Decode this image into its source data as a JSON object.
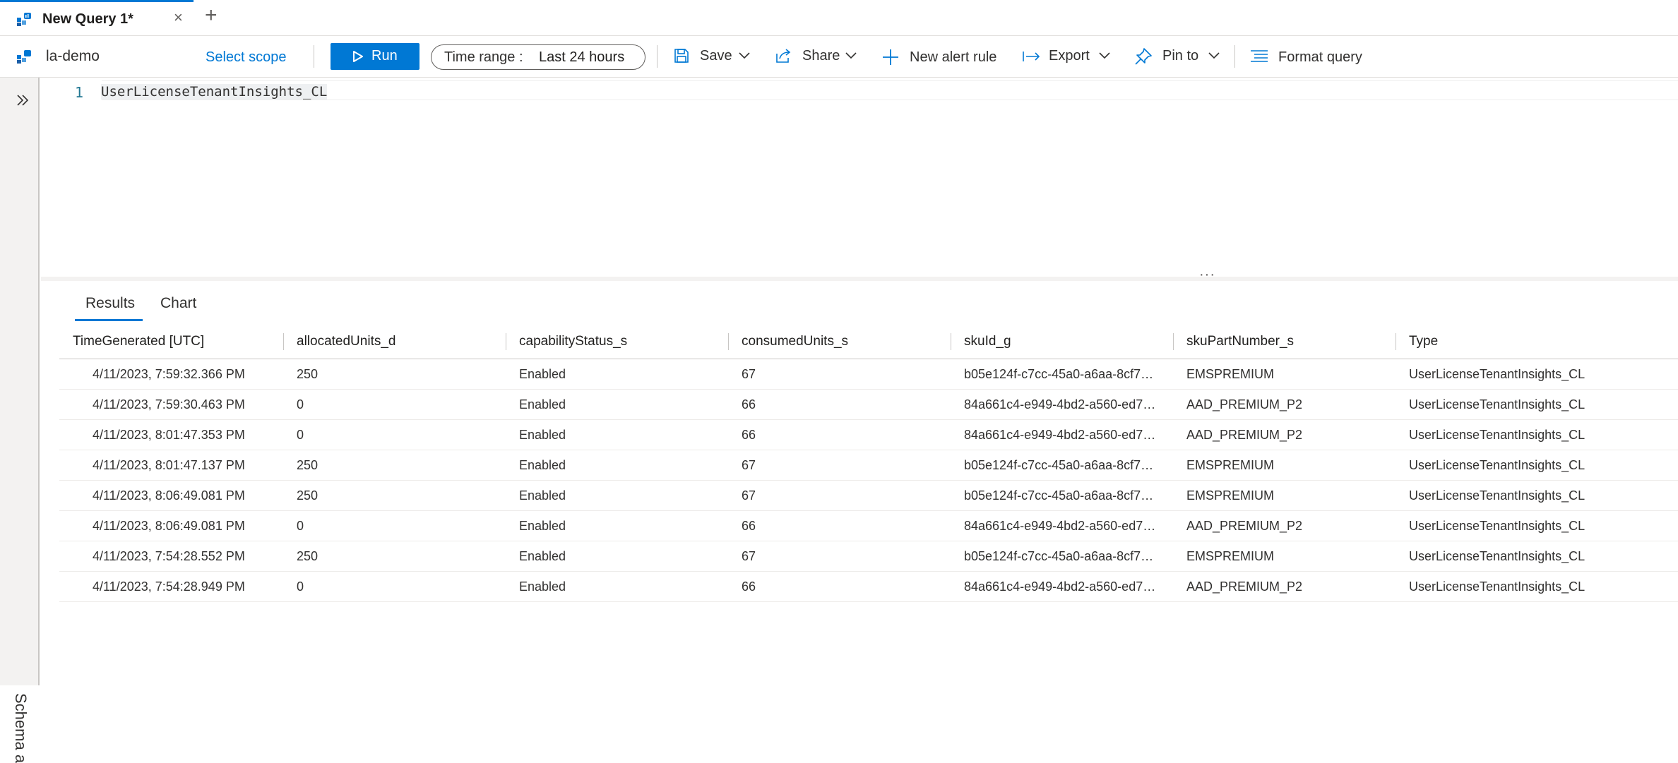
{
  "tab": {
    "title": "New Query 1*",
    "close": "×",
    "add": "+"
  },
  "toolbar": {
    "workspace": "la-demo",
    "select_scope": "Select scope",
    "run": "Run",
    "time_range_label": "Time range :",
    "time_range_value": "Last 24 hours",
    "save": "Save",
    "share": "Share",
    "new_alert_rule": "New alert rule",
    "export": "Export",
    "pin_to": "Pin to",
    "format_query": "Format query"
  },
  "editor": {
    "line_number": "1",
    "query": "UserLicenseTenantInsights_CL"
  },
  "sidebar": {
    "schema_label": "Schema a"
  },
  "results": {
    "tabs": [
      "Results",
      "Chart"
    ],
    "columns": [
      "TimeGenerated [UTC]",
      "allocatedUnits_d",
      "capabilityStatus_s",
      "consumedUnits_s",
      "skuId_g",
      "skuPartNumber_s",
      "Type"
    ],
    "rows": [
      [
        "4/11/2023, 7:59:32.366 PM",
        "250",
        "Enabled",
        "67",
        "b05e124f-c7cc-45a0-a6aa-8cf7…",
        "EMSPREMIUM",
        "UserLicenseTenantInsights_CL"
      ],
      [
        "4/11/2023, 7:59:30.463 PM",
        "0",
        "Enabled",
        "66",
        "84a661c4-e949-4bd2-a560-ed7…",
        "AAD_PREMIUM_P2",
        "UserLicenseTenantInsights_CL"
      ],
      [
        "4/11/2023, 8:01:47.353 PM",
        "0",
        "Enabled",
        "66",
        "84a661c4-e949-4bd2-a560-ed7…",
        "AAD_PREMIUM_P2",
        "UserLicenseTenantInsights_CL"
      ],
      [
        "4/11/2023, 8:01:47.137 PM",
        "250",
        "Enabled",
        "67",
        "b05e124f-c7cc-45a0-a6aa-8cf7…",
        "EMSPREMIUM",
        "UserLicenseTenantInsights_CL"
      ],
      [
        "4/11/2023, 8:06:49.081 PM",
        "250",
        "Enabled",
        "67",
        "b05e124f-c7cc-45a0-a6aa-8cf7…",
        "EMSPREMIUM",
        "UserLicenseTenantInsights_CL"
      ],
      [
        "4/11/2023, 8:06:49.081 PM",
        "0",
        "Enabled",
        "66",
        "84a661c4-e949-4bd2-a560-ed7…",
        "AAD_PREMIUM_P2",
        "UserLicenseTenantInsights_CL"
      ],
      [
        "4/11/2023, 7:54:28.552 PM",
        "250",
        "Enabled",
        "67",
        "b05e124f-c7cc-45a0-a6aa-8cf7…",
        "EMSPREMIUM",
        "UserLicenseTenantInsights_CL"
      ],
      [
        "4/11/2023, 7:54:28.949 PM",
        "0",
        "Enabled",
        "66",
        "84a661c4-e949-4bd2-a560-ed7…",
        "AAD_PREMIUM_P2",
        "UserLicenseTenantInsights_CL"
      ]
    ]
  },
  "colors": {
    "accent": "#0078d4",
    "text": "#323130",
    "border": "#c8c6c4"
  }
}
